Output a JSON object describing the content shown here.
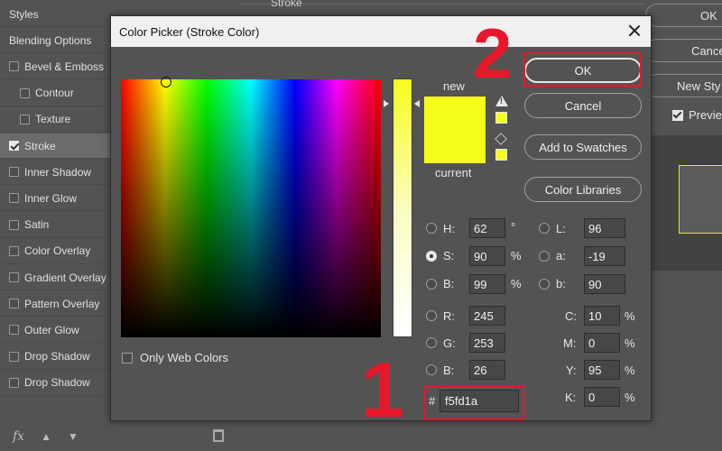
{
  "background": {
    "stroke_label": "Stroke",
    "buttons": [
      "OK",
      "Cance",
      "New Sty"
    ],
    "preview_label": "Previe"
  },
  "styles_panel": {
    "items": [
      {
        "label": "Styles",
        "checkbox": false,
        "checked": false,
        "sub": false
      },
      {
        "label": "Blending Options",
        "checkbox": false,
        "checked": false,
        "sub": false
      },
      {
        "label": "Bevel & Emboss",
        "checkbox": true,
        "checked": false,
        "sub": false
      },
      {
        "label": "Contour",
        "checkbox": true,
        "checked": false,
        "sub": true
      },
      {
        "label": "Texture",
        "checkbox": true,
        "checked": false,
        "sub": true
      },
      {
        "label": "Stroke",
        "checkbox": true,
        "checked": true,
        "sub": false,
        "selected": true
      },
      {
        "label": "Inner Shadow",
        "checkbox": true,
        "checked": false,
        "sub": false
      },
      {
        "label": "Inner Glow",
        "checkbox": true,
        "checked": false,
        "sub": false
      },
      {
        "label": "Satin",
        "checkbox": true,
        "checked": false,
        "sub": false
      },
      {
        "label": "Color Overlay",
        "checkbox": true,
        "checked": false,
        "sub": false
      },
      {
        "label": "Gradient Overlay",
        "checkbox": true,
        "checked": false,
        "sub": false
      },
      {
        "label": "Pattern Overlay",
        "checkbox": true,
        "checked": false,
        "sub": false
      },
      {
        "label": "Outer Glow",
        "checkbox": true,
        "checked": false,
        "sub": false
      },
      {
        "label": "Drop Shadow",
        "checkbox": true,
        "checked": false,
        "sub": false
      },
      {
        "label": "Drop Shadow",
        "checkbox": true,
        "checked": false,
        "sub": false
      }
    ],
    "fx_label": "fx"
  },
  "dialog": {
    "title": "Color Picker (Stroke Color)",
    "new_label": "new",
    "current_label": "current",
    "new_color": "#f5fd1a",
    "current_color": "#f5fd1a",
    "buttons": {
      "ok": "OK",
      "cancel": "Cancel",
      "add_to_swatches": "Add to Swatches",
      "color_libraries": "Color Libraries"
    },
    "only_web_colors": "Only Web Colors",
    "hsb": {
      "h": {
        "label": "H:",
        "value": "62",
        "unit": "°"
      },
      "s": {
        "label": "S:",
        "value": "90",
        "unit": "%"
      },
      "b": {
        "label": "B:",
        "value": "99",
        "unit": "%"
      }
    },
    "rgb": {
      "r": {
        "label": "R:",
        "value": "245"
      },
      "g": {
        "label": "G:",
        "value": "253"
      },
      "b": {
        "label": "B:",
        "value": "26"
      }
    },
    "lab": {
      "l": {
        "label": "L:",
        "value": "96"
      },
      "a": {
        "label": "a:",
        "value": "-19"
      },
      "b": {
        "label": "b:",
        "value": "90"
      }
    },
    "cmyk": {
      "c": {
        "label": "C:",
        "value": "10",
        "unit": "%"
      },
      "m": {
        "label": "M:",
        "value": "0",
        "unit": "%"
      },
      "y": {
        "label": "Y:",
        "value": "95",
        "unit": "%"
      },
      "k": {
        "label": "K:",
        "value": "0",
        "unit": "%"
      }
    },
    "hex_label": "#",
    "hex_value": "f5fd1a"
  },
  "annotations": {
    "step1": "1",
    "step2": "2",
    "highlight_color": "#e8182a"
  }
}
